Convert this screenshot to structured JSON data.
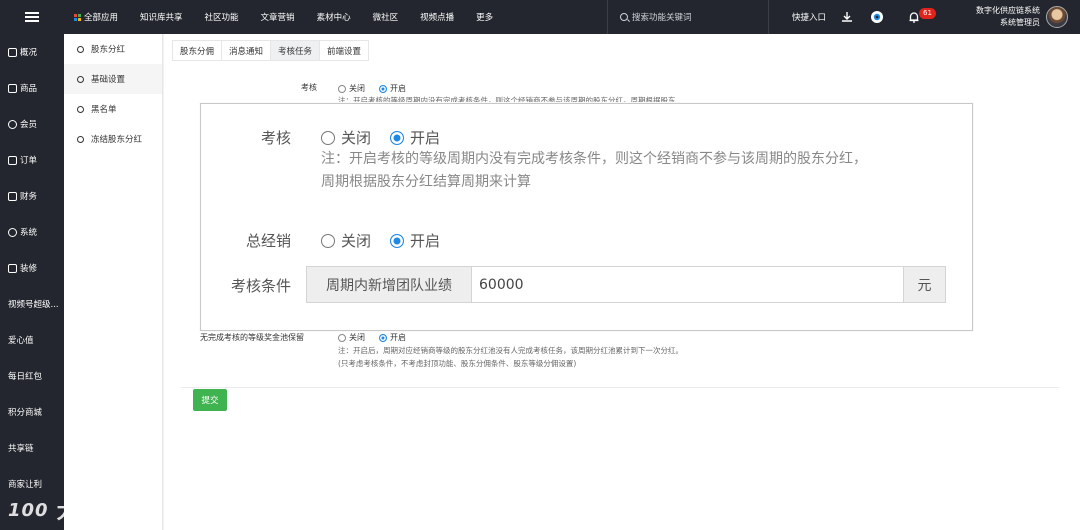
{
  "topbar": {
    "nav": [
      "全部应用",
      "知识库共享",
      "社区功能",
      "文章营销",
      "素材中心",
      "微社区",
      "视频点播",
      "更多"
    ],
    "search_placeholder": "搜索功能关键词",
    "quick_entry": "快捷入口",
    "notification_count": "61",
    "user_line1": "数字化供应链系统",
    "user_line2": "系统管理员"
  },
  "sidebar": {
    "items": [
      "概况",
      "商品",
      "会员",
      "订单",
      "财务",
      "系统",
      "装修",
      "视频号超级...",
      "爱心值",
      "每日红包",
      "积分商城",
      "共享链",
      "商家让利"
    ]
  },
  "subnav": {
    "items": [
      "股东分红",
      "基础设置",
      "黑名单",
      "冻结股东分红"
    ],
    "active_index": 1
  },
  "tabs": {
    "items": [
      "股东分佣",
      "消息通知",
      "考核任务",
      "前端设置"
    ],
    "active_index": 2
  },
  "form": {
    "assessment_label": "考核",
    "off_label": "关闭",
    "on_label": "开启",
    "assessment_note_line1": "注：开启考核的等级周期内没有完成考核条件，则这个经销商不参与该周期的股东分红，",
    "assessment_note_line2": "周期根据股东分红结算周期来计算",
    "assessment_note_small": "注：开启考核的等级周期内没有完成考核条件，则这个经销商不参与该周期的股东分红，周期根据股东",
    "general_label": "总经销",
    "condition_label": "考核条件",
    "condition_prefix": "周期内新增团队业绩",
    "condition_value": "60000",
    "condition_suffix": "元",
    "pool_label": "无完成考核的等级奖金池保留",
    "pool_note_line1": "注：开启后，周期对应经销商等级的股东分红池没有人完成考核任务，该周期分红池累计到下一次分红。",
    "pool_note_line2": "(只考虑考核条件，不考虑封顶功能、股东分佣条件、股东等级分佣设置)",
    "submit_label": "提交"
  },
  "watermark": {
    "logo_text": "100",
    "brand_text": "大数跨境"
  },
  "colors": {
    "topbar_bg": "#23262e",
    "accent_blue": "#1e88e5",
    "submit_green": "#3fb34f",
    "badge_red": "#e0241b"
  }
}
